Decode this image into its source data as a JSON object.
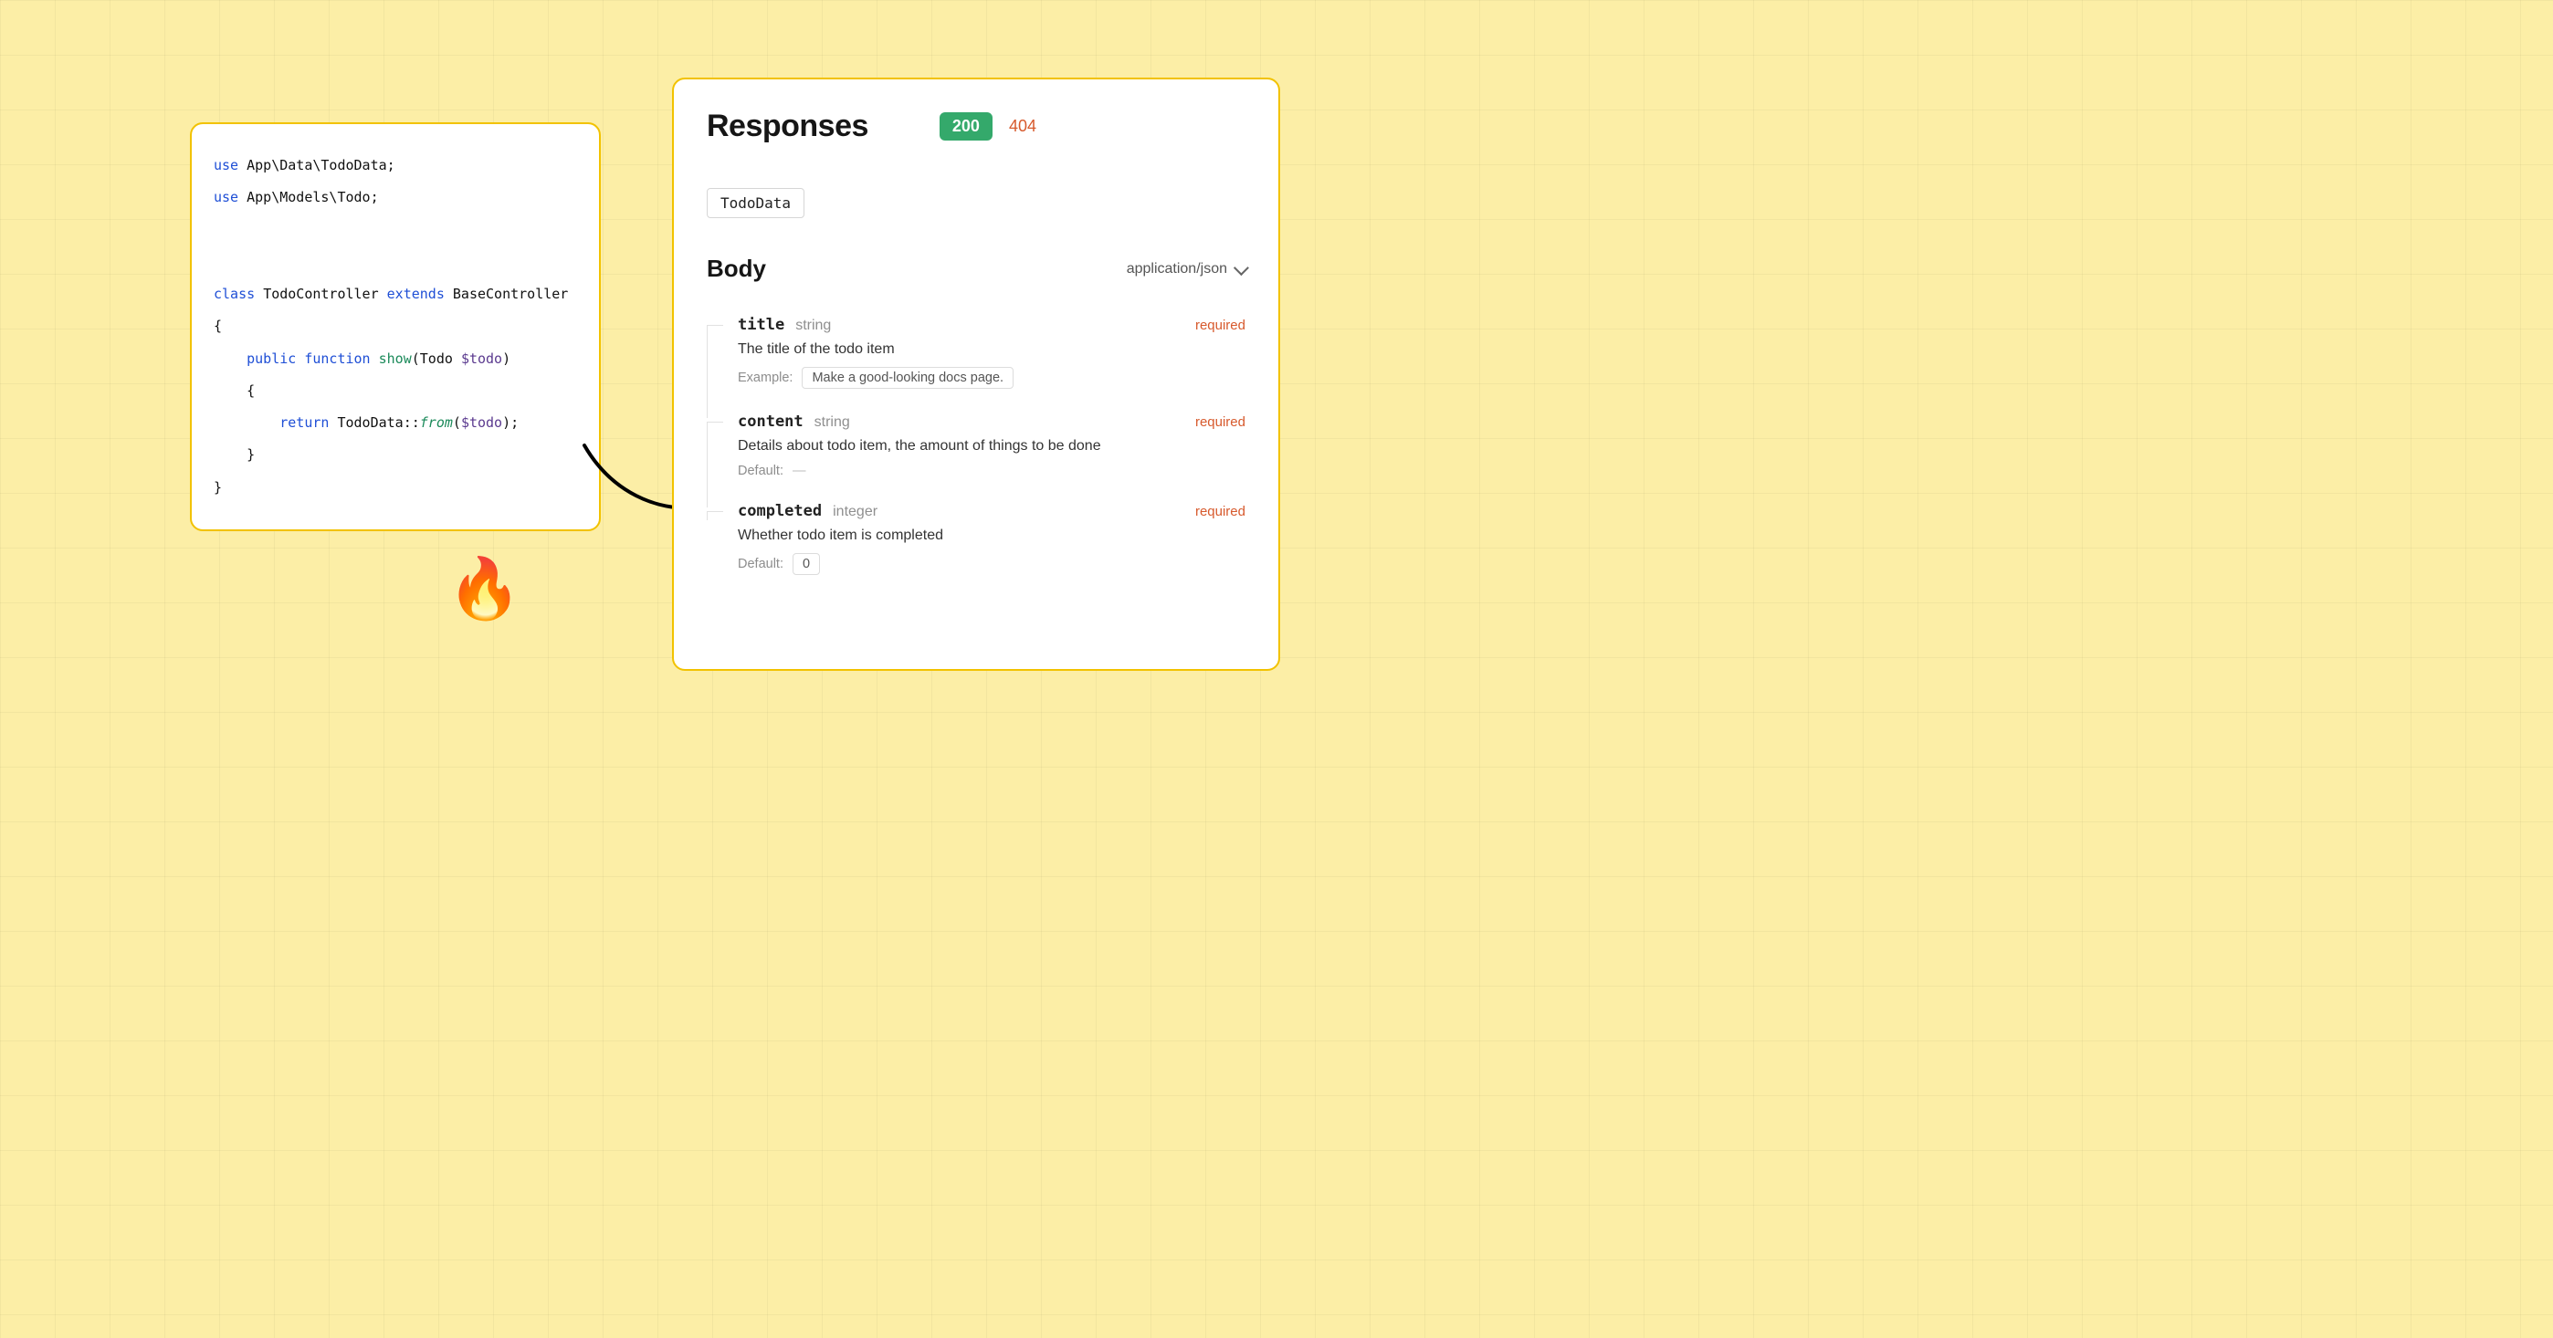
{
  "code": {
    "kw_use": "use",
    "ns_tododata": "App\\Data\\TodoData",
    "ns_todo": "App\\Models\\Todo",
    "kw_class": "class",
    "class_name": "TodoController",
    "kw_extends": "extends",
    "base_class": "BaseController",
    "kw_public": "public",
    "kw_function": "function",
    "fn_show": "show",
    "type_todo": "Todo",
    "var_todo": "$todo",
    "kw_return": "return",
    "static_class": "TodoData",
    "static_sep": "::",
    "static_method": "from"
  },
  "fire_emoji": "🔥",
  "responses": {
    "title": "Responses",
    "codes": {
      "ok": "200",
      "notfound": "404"
    },
    "schema_name": "TodoData",
    "body_label": "Body",
    "content_type": "application/json",
    "fields": [
      {
        "name": "title",
        "type": "string",
        "required": "required",
        "description": "The title of the todo item",
        "meta_label": "Example:",
        "meta_value": "Make a good-looking docs page."
      },
      {
        "name": "content",
        "type": "string",
        "required": "required",
        "description": "Details about todo item, the amount of things to be done",
        "meta_label": "Default:",
        "meta_value": "—"
      },
      {
        "name": "completed",
        "type": "integer",
        "required": "required",
        "description": "Whether todo item is completed",
        "meta_label": "Default:",
        "meta_value": "0"
      }
    ]
  }
}
